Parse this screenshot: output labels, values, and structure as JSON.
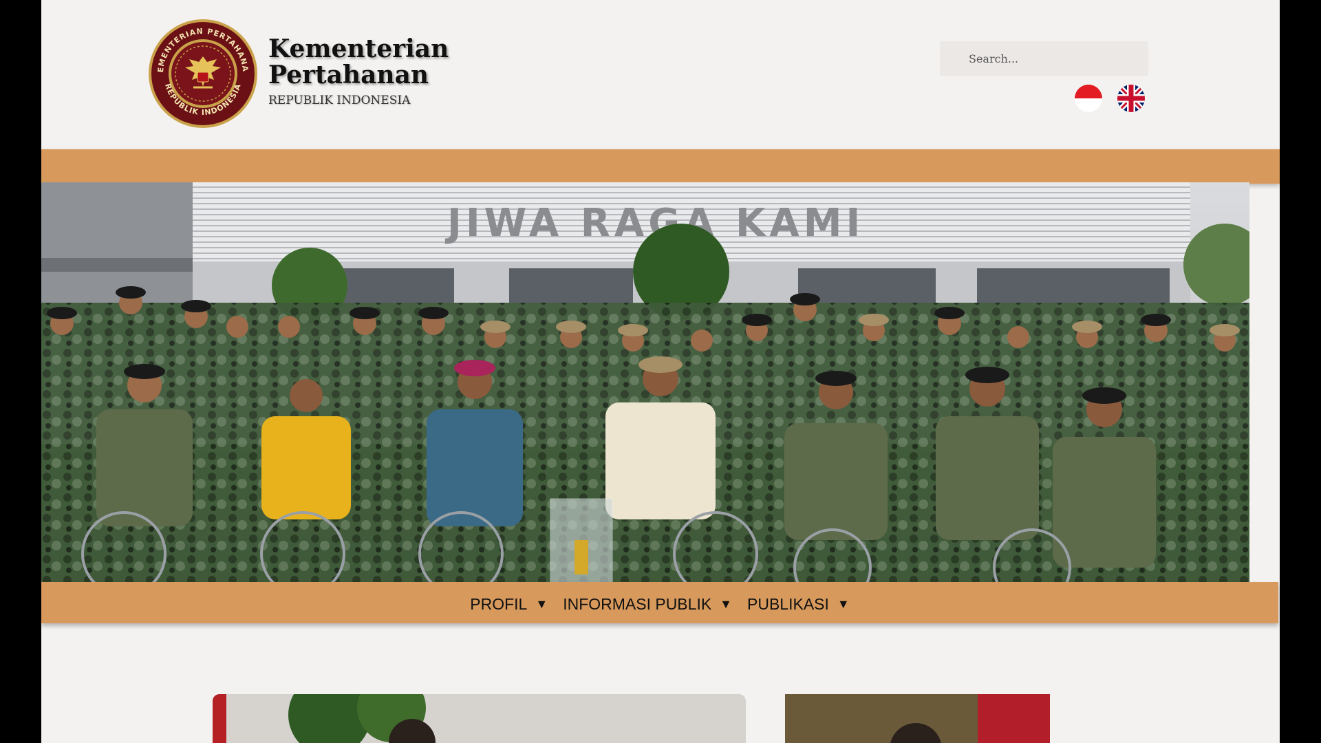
{
  "header": {
    "logo_ring_top": "KEMENTERIAN PERTAHANAN",
    "logo_ring_bottom": "REPUBLIK INDONESIA",
    "title_line1": "Kementerian",
    "title_line2": "Pertahanan",
    "subtitle": "REPUBLIK INDONESIA",
    "search_placeholder": "Search...",
    "languages": [
      {
        "name": "Indonesian",
        "icon": "indonesia-flag-icon"
      },
      {
        "name": "English",
        "icon": "uk-flag-icon"
      }
    ]
  },
  "hero": {
    "building_sign": "JIWA RAGA KAMI",
    "icon": "group-photo"
  },
  "nav": {
    "items": [
      {
        "label": "PROFIL",
        "icon": "caret-down-icon"
      },
      {
        "label": "INFORMASI PUBLIK",
        "icon": "caret-down-icon"
      },
      {
        "label": "PUBLIKASI",
        "icon": "caret-down-icon"
      }
    ]
  },
  "colors": {
    "band": "#d89a5c",
    "page_bg": "#f4f2f0",
    "logo_maroon": "#6b1116",
    "logo_gold": "#c9a24a"
  }
}
